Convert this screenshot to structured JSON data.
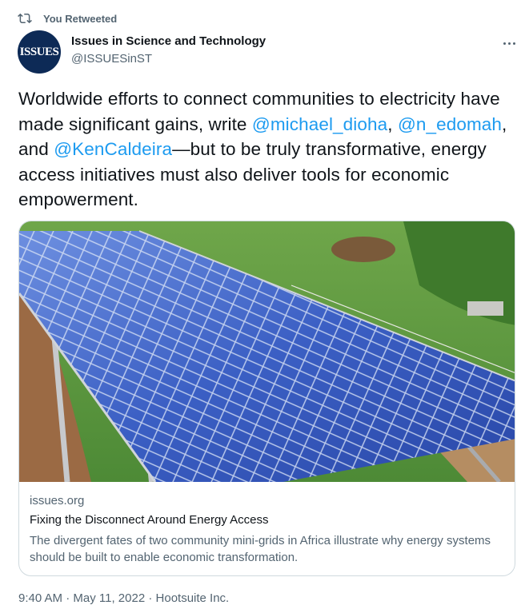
{
  "retweet": {
    "icon": "retweet-icon",
    "label": "You Retweeted"
  },
  "author": {
    "avatar_text": "ISSUES",
    "name": "Issues in Science and Technology",
    "handle": "@ISSUESinST"
  },
  "tweet": {
    "text_1": "Worldwide efforts to connect communities to electricity have made significant gains, write ",
    "mention_1": "@michael_dioha",
    "text_2": ", ",
    "mention_2": "@n_edomah",
    "text_3": ", and ",
    "mention_3": "@KenCaldeira",
    "text_4": "—but to be truly transformative, energy access initiatives must also deliver tools for economic empowerment."
  },
  "card": {
    "image_alt": "solar panel array",
    "domain": "issues.org",
    "title": "Fixing the Disconnect Around Energy Access",
    "description": "The divergent fates of two community mini-grids in Africa illustrate why energy systems should be built to enable economic transformation."
  },
  "meta": {
    "time": "9:40 AM",
    "date": "May 11, 2022",
    "source": "Hootsuite Inc."
  },
  "colors": {
    "accent": "#1d9bf0",
    "secondary_text": "#536471",
    "border": "#cfd9de"
  }
}
